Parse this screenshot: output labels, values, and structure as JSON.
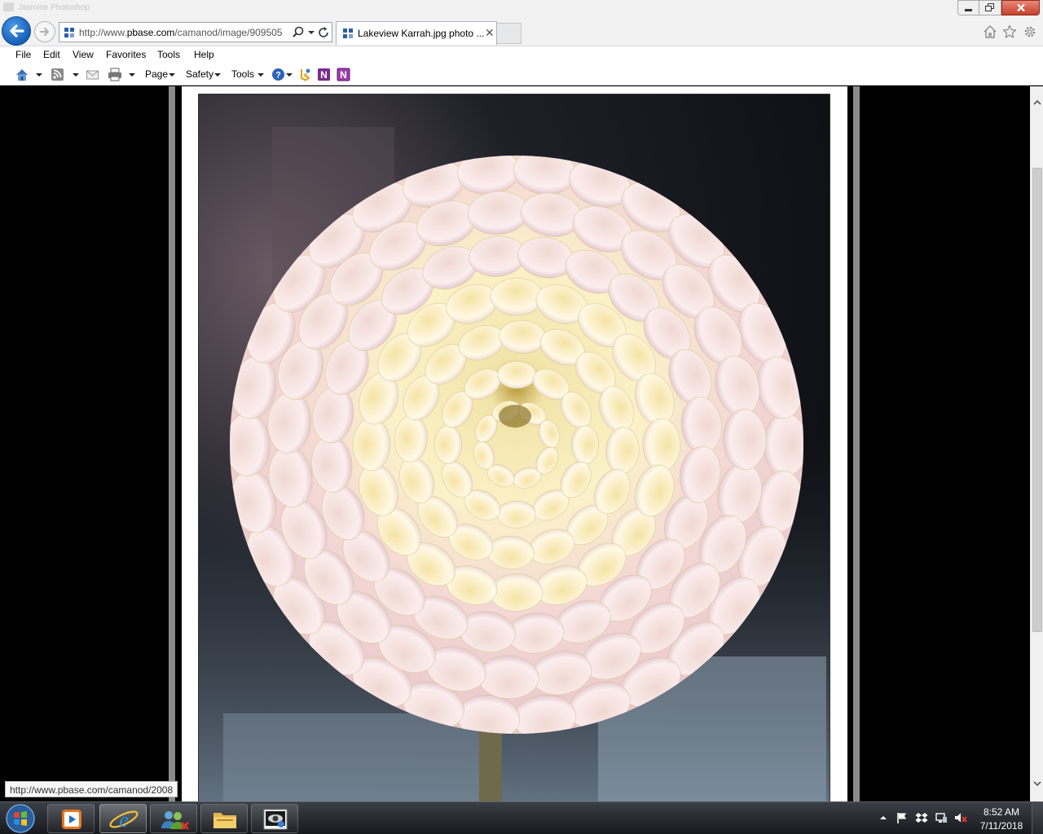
{
  "window": {
    "ghost_title": "Jasmine Photoshop",
    "tab_title": "Lakeview Karrah.jpg photo ..."
  },
  "address_bar": {
    "url_prefix": "http://www.",
    "url_domain": "pbase.com",
    "url_path": "/camanod/image/909505"
  },
  "menu": {
    "items": [
      "File",
      "Edit",
      "View",
      "Favorites",
      "Tools",
      "Help"
    ]
  },
  "command_bar": {
    "page_label": "Page",
    "safety_label": "Safety",
    "tools_label": "Tools",
    "icons": [
      "home-icon",
      "rss-feed-icon",
      "read-mail-icon",
      "print-icon",
      "help-icon",
      "bing-translator-icon",
      "onenote-icon",
      "onenote-linked-icon"
    ]
  },
  "content": {
    "photo_subject": "dahlia flower photo",
    "frame_color": "#ffffff",
    "background_color": "#000000"
  },
  "status": {
    "hover_url": "http://www.pbase.com/camanod/2008"
  },
  "taskbar": {
    "apps": [
      "windows-media-player",
      "internet-explorer",
      "user-accounts",
      "file-explorer",
      "photo-viewer"
    ],
    "time": "8:52 AM",
    "date": "7/11/2018"
  },
  "colors": {
    "accent": "#1b6dc1",
    "close_button": "#c7402c",
    "taskbar": "#1f2226"
  }
}
